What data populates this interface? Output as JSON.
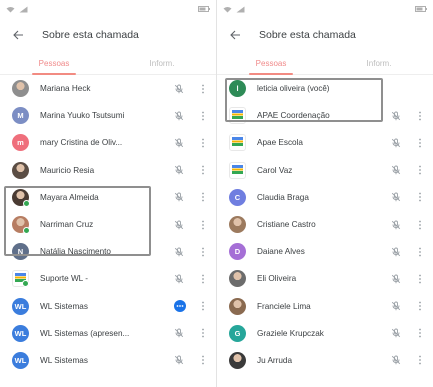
{
  "status_bar": {
    "left": {
      "time": "",
      "icons": [
        "wifi-icon",
        "signal-icon"
      ]
    },
    "right": {
      "text": "",
      "icons": [
        "battery-icon"
      ]
    }
  },
  "left_screen": {
    "header": {
      "title": "Sobre esta chamada"
    },
    "tabs": [
      {
        "label": "Pessoas",
        "active": true
      },
      {
        "label": "Inform.",
        "active": false
      }
    ],
    "people": [
      {
        "name": "Mariana Heck",
        "avatar": "photo",
        "color": "#8e8e8e",
        "mic": "muted"
      },
      {
        "name": "Marina Yuuko Tsutsumi",
        "avatar": "letter",
        "letter": "M",
        "color": "#7c8ec4",
        "mic": "muted"
      },
      {
        "name": "mary Cristina de Oliv...",
        "avatar": "letter",
        "letter": "m",
        "color": "#ef6f7c",
        "mic": "muted"
      },
      {
        "name": "Mauricio Resia",
        "avatar": "photo",
        "color": "#5b4d44",
        "mic": "muted"
      },
      {
        "name": "Mayara Almeida",
        "avatar": "photo",
        "color": "#4a3b33",
        "mic": "muted",
        "online": true
      },
      {
        "name": "Narriman Cruz",
        "avatar": "photo",
        "color": "#b77d62",
        "mic": "muted",
        "online": true
      },
      {
        "name": "Natália Nascimento",
        "avatar": "letter",
        "letter": "N",
        "color": "#5f6f8a",
        "mic": "muted"
      },
      {
        "name": "Suporte WL -",
        "avatar": "logo",
        "color": "#ffffff",
        "mic": "muted",
        "online": true
      },
      {
        "name": "WL Sistemas",
        "avatar": "letter",
        "letter": "WL",
        "color": "#3b7ddd",
        "mic": "speaking"
      },
      {
        "name": "WL Sistemas (apresen...",
        "avatar": "letter",
        "letter": "WL",
        "color": "#3b7ddd",
        "mic": "muted"
      },
      {
        "name": "WL Sistemas",
        "avatar": "letter",
        "letter": "WL",
        "color": "#3b7ddd",
        "mic": "muted"
      }
    ]
  },
  "right_screen": {
    "header": {
      "title": "Sobre esta chamada"
    },
    "tabs": [
      {
        "label": "Pessoas",
        "active": true
      },
      {
        "label": "Inform.",
        "active": false
      }
    ],
    "people": [
      {
        "name": "leticia oliveira (você)",
        "avatar": "letter",
        "letter": "l",
        "color": "#2e8b57",
        "mic": "none",
        "you": true
      },
      {
        "name": "APAE Coordenação",
        "avatar": "logo",
        "color": "#ffffff",
        "mic": "muted"
      },
      {
        "name": "Apae Escola",
        "avatar": "logo",
        "color": "#ffffff",
        "mic": "muted"
      },
      {
        "name": "Carol Vaz",
        "avatar": "logo",
        "color": "#ffffff",
        "mic": "muted"
      },
      {
        "name": "Claudia Braga",
        "avatar": "letter",
        "letter": "C",
        "color": "#6f7ee0",
        "mic": "muted"
      },
      {
        "name": "Cristiane Castro",
        "avatar": "photo",
        "color": "#9c7a5e",
        "mic": "muted"
      },
      {
        "name": "Daiane Alves",
        "avatar": "letter",
        "letter": "D",
        "color": "#a56fd6",
        "mic": "muted"
      },
      {
        "name": "Eli Oliveira",
        "avatar": "photo",
        "color": "#6c6c6c",
        "mic": "muted"
      },
      {
        "name": "Franciele Lima",
        "avatar": "photo",
        "color": "#8a6a50",
        "mic": "muted"
      },
      {
        "name": "Graziele Krupczak",
        "avatar": "letter",
        "letter": "G",
        "color": "#26a69a",
        "mic": "muted"
      },
      {
        "name": "Ju Arruda",
        "avatar": "photo",
        "color": "#3a3a3a",
        "mic": "muted"
      }
    ]
  }
}
